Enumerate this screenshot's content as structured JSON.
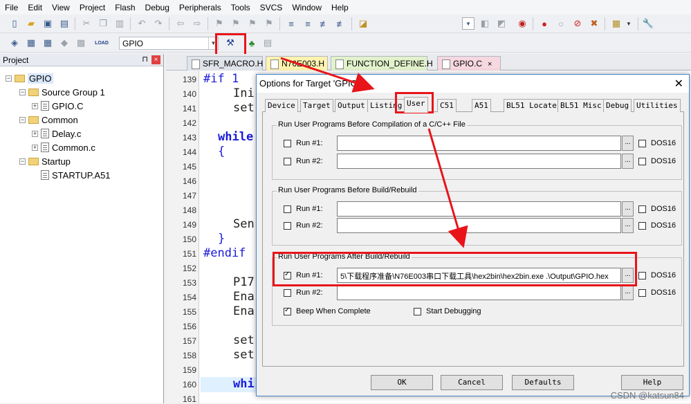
{
  "menu": [
    "File",
    "Edit",
    "View",
    "Project",
    "Flash",
    "Debug",
    "Peripherals",
    "Tools",
    "SVCS",
    "Window",
    "Help"
  ],
  "toolbar": {
    "target_name": "GPIO",
    "load_label": "LOAD"
  },
  "project": {
    "title": "Project",
    "root": "GPIO",
    "groups": [
      {
        "name": "Source Group 1",
        "files": [
          "GPIO.C"
        ]
      },
      {
        "name": "Common",
        "files": [
          "Delay.c",
          "Common.c"
        ]
      },
      {
        "name": "Startup",
        "files": [
          "STARTUP.A51"
        ]
      }
    ]
  },
  "editor": {
    "tabs": [
      "SFR_MACRO.H",
      "N76E003.H",
      "FUNCTION_DEFINE.H",
      "GPIO.C"
    ],
    "line_numbers": [
      "139",
      "140",
      "141",
      "142",
      "143",
      "144",
      "145",
      "146",
      "147",
      "148",
      "149",
      "150",
      "151",
      "152",
      "153",
      "154",
      "155",
      "156",
      "157",
      "158",
      "159",
      "160",
      "161"
    ],
    "code": {
      "l139": "#if 1",
      "l140": "Ini",
      "l141": "set",
      "l143": "while",
      "l144": "{",
      "l149": "Sen",
      "l150": "}",
      "l151": "#endif",
      "l153": "P17",
      "l154": "Ena",
      "l155": "Ena",
      "l157": "set",
      "l158": "set",
      "l160": "whi"
    }
  },
  "dialog": {
    "title": "Options for Target 'GPIO'",
    "tabs": [
      "Device",
      "Target",
      "Output",
      "Listing",
      "User",
      "C51",
      "A51",
      "BL51 Locate",
      "BL51 Misc",
      "Debug",
      "Utilities"
    ],
    "group1": {
      "title": "Run User Programs Before Compilation of a C/C++ File",
      "run1": "Run #1:",
      "run2": "Run #2:",
      "dos": "DOS16"
    },
    "group2": {
      "title": "Run User Programs Before Build/Rebuild",
      "run1": "Run #1:",
      "run2": "Run #2:",
      "dos": "DOS16"
    },
    "group3": {
      "title": "Run User Programs After Build/Rebuild",
      "run1": "Run #1:",
      "run2": "Run #2:",
      "dos": "DOS16",
      "run1_value": "5\\下载程序准备\\N76E003串口下载工具\\hex2bin\\hex2bin.exe .\\Output\\GPIO.hex"
    },
    "beep": "Beep When Complete",
    "start_debug": "Start Debugging",
    "browse": "...",
    "buttons": {
      "ok": "OK",
      "cancel": "Cancel",
      "defaults": "Defaults",
      "help": "Help"
    }
  },
  "watermark": "CSDN @katsun84",
  "colors": {
    "highlight": "#e8141a",
    "keyword": "#1b1bd8"
  }
}
